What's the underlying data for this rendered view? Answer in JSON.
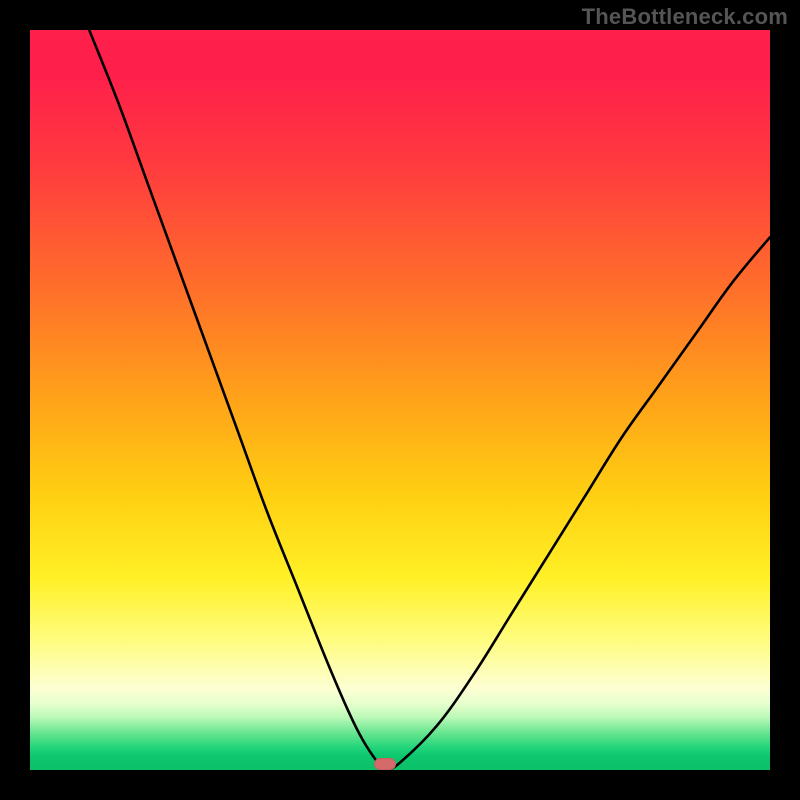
{
  "watermark": "TheBottleneck.com",
  "colors": {
    "curve": "#000000",
    "marker": "#d46a6a",
    "frame": "#000000"
  },
  "chart_data": {
    "type": "line",
    "title": "",
    "xlabel": "",
    "ylabel": "",
    "xlim": [
      0,
      100
    ],
    "ylim": [
      0,
      100
    ],
    "grid": false,
    "legend": false,
    "note": "V-shaped bottleneck curve; vertical axis inverted (0 at bottom = best). Background gradient encodes severity: green (low) near bottom, red (high) near top.",
    "series": [
      {
        "name": "bottleneck-curve",
        "x": [
          8,
          12,
          16,
          20,
          24,
          28,
          32,
          36,
          40,
          43,
          45,
          47,
          48,
          50,
          55,
          60,
          65,
          70,
          75,
          80,
          85,
          90,
          95,
          100
        ],
        "y": [
          100,
          90,
          79,
          68,
          57,
          46,
          35,
          25,
          15,
          8,
          4,
          1,
          0,
          1,
          6,
          13,
          21,
          29,
          37,
          45,
          52,
          59,
          66,
          72
        ]
      }
    ],
    "min_point": {
      "x": 48,
      "y": 0
    }
  }
}
